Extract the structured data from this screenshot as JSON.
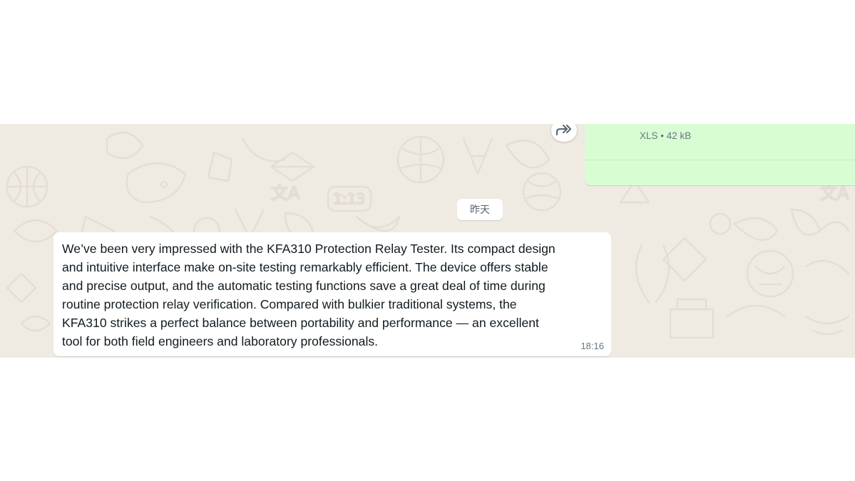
{
  "outgoing_message": {
    "file_meta": "XLS • 42 kB"
  },
  "forward_button": {
    "icon": "forward-icon"
  },
  "date_separator": {
    "label": "昨天"
  },
  "incoming_message": {
    "lines": [
      "We’ve been very impressed with the KFA310 Protection Relay Tester. Its compact design",
      "and intuitive interface make on-site testing remarkably efficient. The device offers stable",
      "and precise output, and the automatic testing functions save a great deal of time during",
      "routine protection relay verification. Compared with bulkier traditional systems, the",
      "KFA310 strikes a perfect balance between portability and performance — an excellent",
      "tool for both field engineers and laboratory professionals."
    ],
    "time": "18:16"
  },
  "colors": {
    "chat_background": "#efeae2",
    "outgoing_bubble": "#d9fdd3",
    "incoming_bubble": "#ffffff",
    "text_primary": "#111b21",
    "text_secondary": "#667781"
  }
}
